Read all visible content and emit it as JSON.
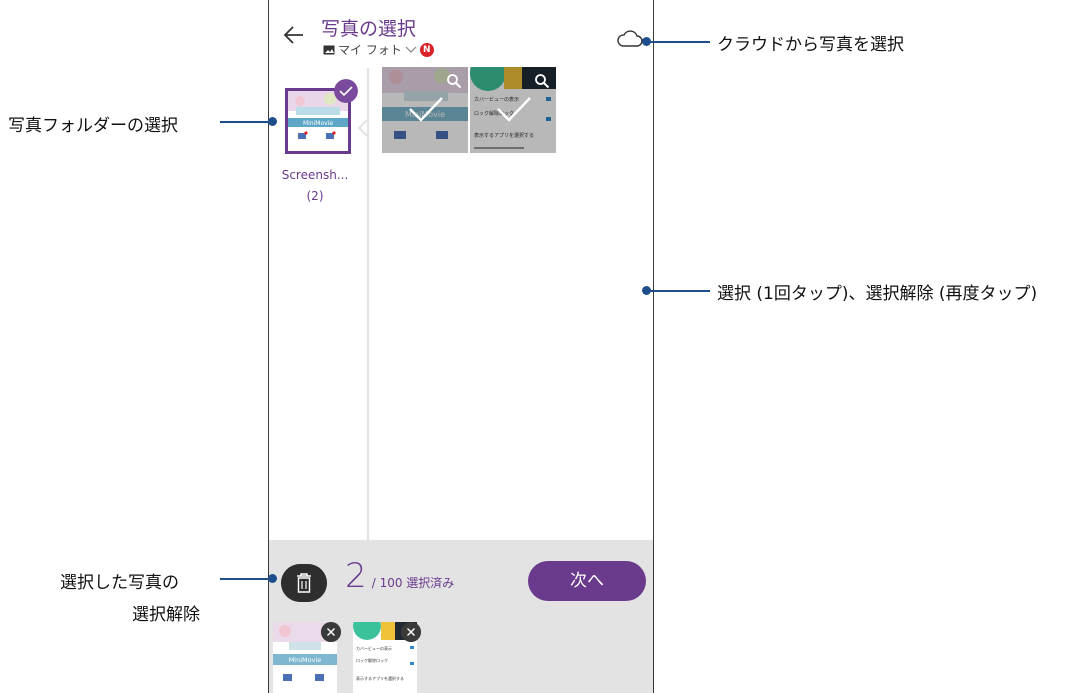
{
  "header": {
    "title": "写真の選択",
    "subtitle": "マイ フォト",
    "badge": "N"
  },
  "folders": [
    {
      "name": "Screensh...",
      "count": "(2)"
    }
  ],
  "photo_thumbs": [
    {
      "label": "MiniMovie",
      "kind": "minimovie"
    },
    {
      "label": "カバービューの表示",
      "kind": "settings"
    }
  ],
  "thumb_text": {
    "app_name": "MiniMovie",
    "items": [
      "カバービューの表示",
      "ロック解除ロック",
      "表示するアプリを選択する"
    ]
  },
  "selection": {
    "count": "2",
    "limit_text": "/ 100 選択済み",
    "next_label": "次へ"
  },
  "callouts": {
    "cloud": "クラウドから写真を選択",
    "folder": "写真フォルダーの選択",
    "select": "選択 (1回タップ)、選択解除 (再度タップ)",
    "deselect_line1": "選択した写真の",
    "deselect_line2": "選択解除"
  },
  "colors": {
    "accent": "#6a3a8c",
    "callout_line": "#1f4e8c",
    "bottom_bar": "#e3e3e3",
    "badge": "#d8232a"
  }
}
